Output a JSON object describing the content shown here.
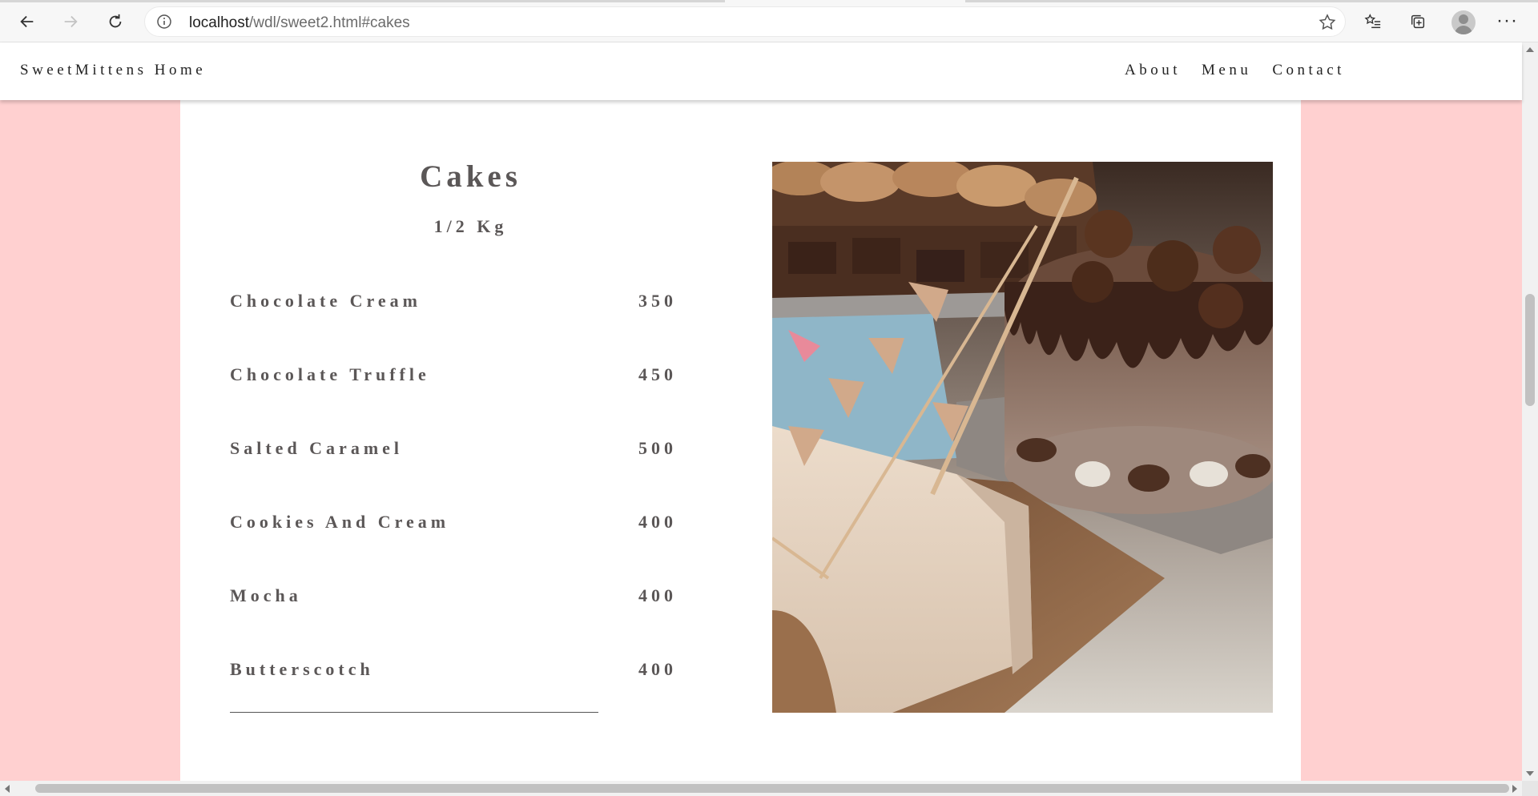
{
  "browser": {
    "url_host": "localhost",
    "url_path": "/wdl/sweet2.html#cakes",
    "icons": [
      "back-icon",
      "forward-icon",
      "refresh-icon",
      "info-icon",
      "star-icon",
      "favorites-icon",
      "collections-icon",
      "profile-icon",
      "more-icon"
    ],
    "more_label": "···"
  },
  "site_nav": {
    "brand": "SweetMittens Home",
    "links": [
      "About",
      "Menu",
      "Contact"
    ]
  },
  "menu": {
    "title": "Cakes",
    "subtitle": "1/2 Kg",
    "items": [
      {
        "name": "Chocolate Cream",
        "price": "350"
      },
      {
        "name": "Chocolate Truffle",
        "price": "450"
      },
      {
        "name": "Salted Caramel",
        "price": "500"
      },
      {
        "name": "Cookies And Cream",
        "price": "400"
      },
      {
        "name": "Mocha",
        "price": "400"
      },
      {
        "name": "Butterscotch",
        "price": "400"
      }
    ]
  },
  "colors": {
    "page_background": "#ffd0d0",
    "card_background": "#ffffff",
    "menu_text": "#5b5757"
  }
}
